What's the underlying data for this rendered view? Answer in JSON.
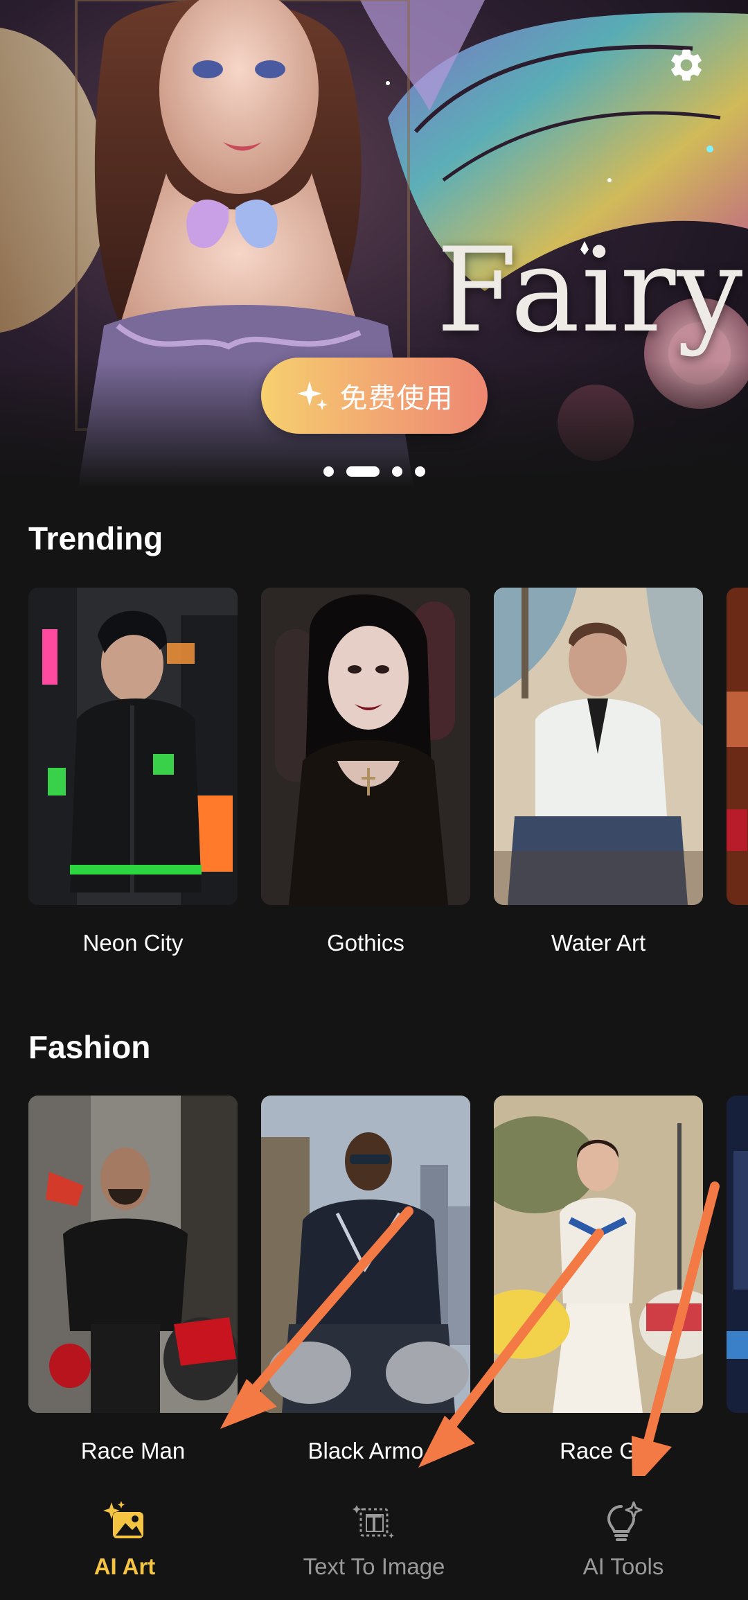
{
  "hero": {
    "title_art": "Fairy",
    "cta_label": "免费使用",
    "cta_icon": "sparkle-icon",
    "settings_icon": "gear-icon",
    "page_dots": 4,
    "active_dot": 2
  },
  "sections": [
    {
      "title": "Trending",
      "cards": [
        {
          "name": "Neon City"
        },
        {
          "name": "Gothics"
        },
        {
          "name": "Water Art"
        }
      ]
    },
    {
      "title": "Fashion",
      "cards": [
        {
          "name": "Race Man"
        },
        {
          "name": "Black Armo"
        },
        {
          "name": "Race G"
        }
      ]
    }
  ],
  "nav": {
    "items": [
      {
        "label": "AI Art",
        "icon": "image-sparkle-icon",
        "active": true
      },
      {
        "label": "Text To Image",
        "icon": "text-frame-icon",
        "active": false
      },
      {
        "label": "AI Tools",
        "icon": "lightbulb-sparkle-icon",
        "active": false
      }
    ]
  },
  "colors": {
    "background": "#141414",
    "accent": "#f5c442",
    "cta_gradient_start": "#f6d06f",
    "cta_gradient_end": "#ed8771",
    "annotation_arrow": "#f47a45"
  }
}
